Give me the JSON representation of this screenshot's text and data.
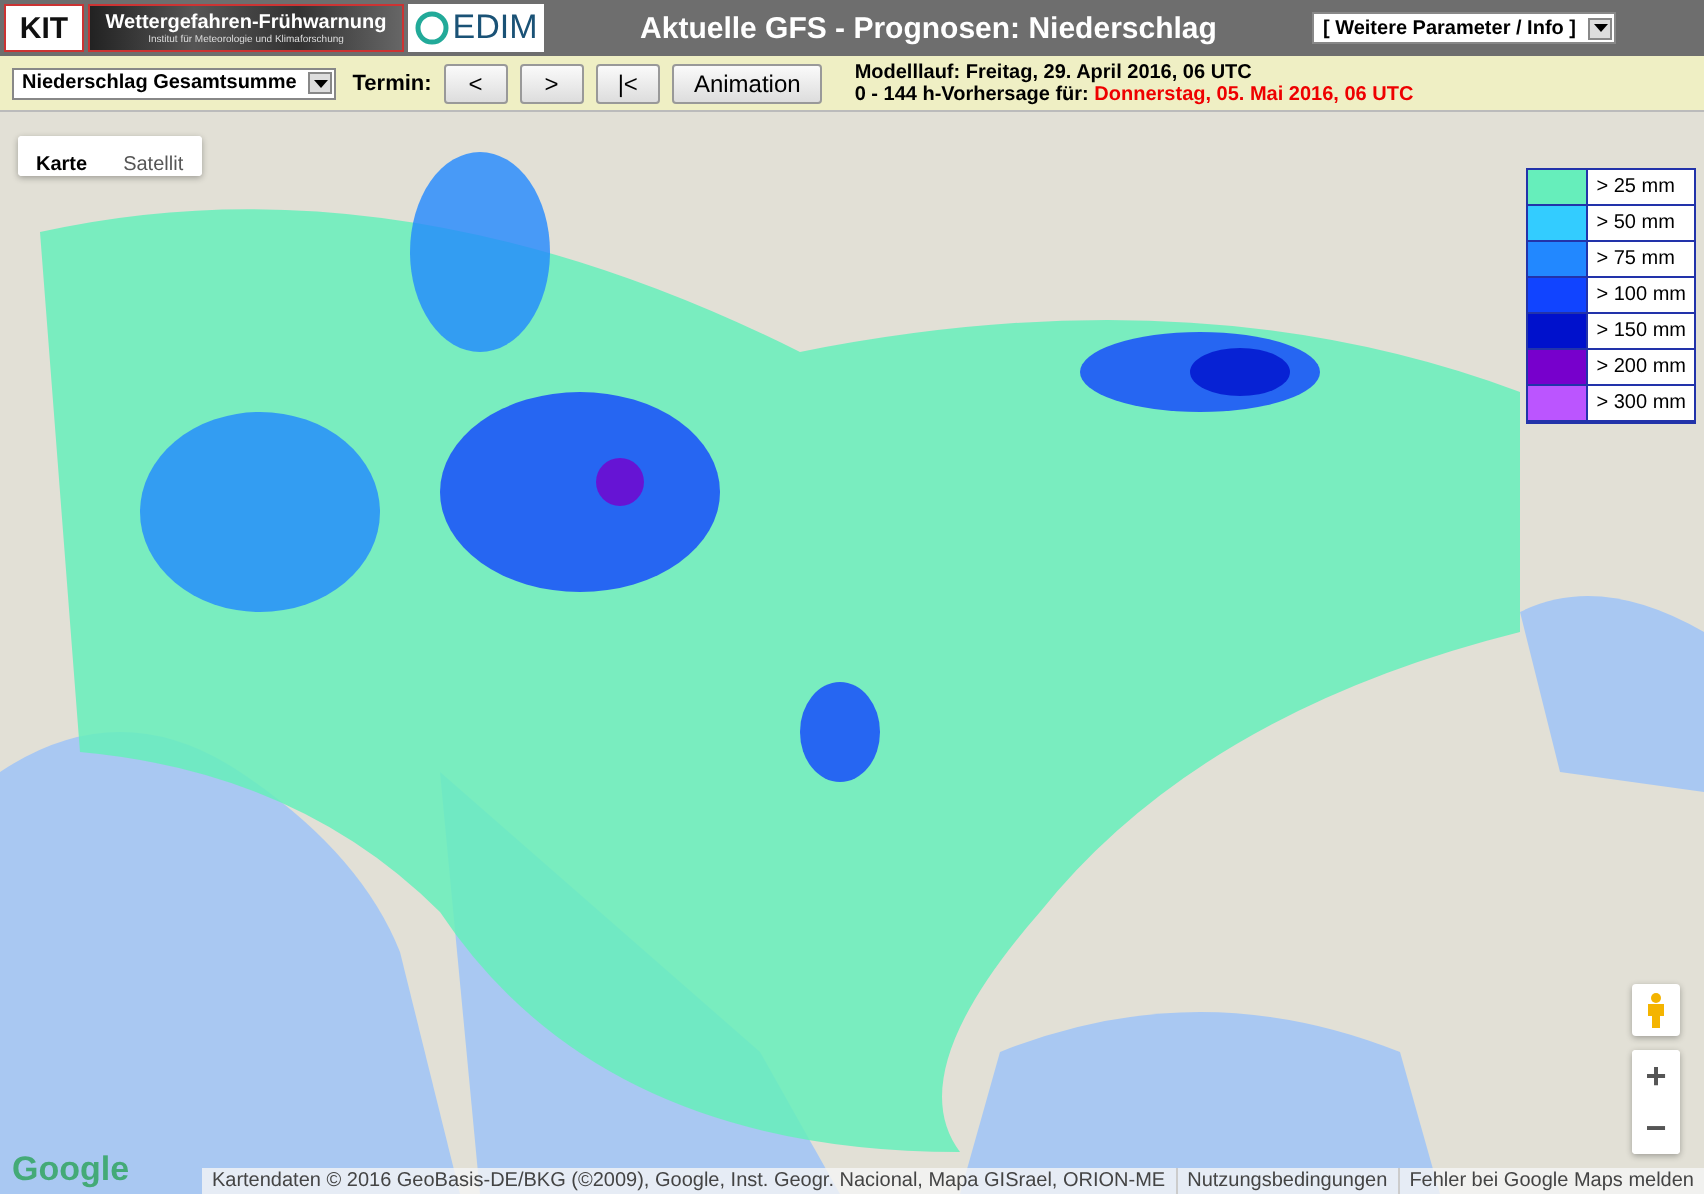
{
  "header": {
    "logos": [
      {
        "kind": "kit",
        "text": "KIT"
      },
      {
        "kind": "banner",
        "text": "Wettergefahren-Frühwarnung",
        "subtext": "Institut für Meteorologie und Klimaforschung"
      },
      {
        "kind": "cedim",
        "text": "EDIM"
      }
    ],
    "title": "Aktuelle GFS - Prognosen: Niederschlag",
    "menu": "[ Weitere Parameter / Info ]"
  },
  "toolbar": {
    "parameter": "Niederschlag Gesamtsumme",
    "termin_label": "Termin:",
    "buttons": [
      "<",
      ">",
      "|<",
      "Animation"
    ],
    "model_run": "Modelllauf: Freitag, 29. April 2016, 06 UTC",
    "forecast_label": "0 - 144 h-Vorhersage für:",
    "forecast_date": "Donnerstag, 05. Mai 2016, 06 UTC"
  },
  "map": {
    "type_tabs": [
      {
        "label": "Karte",
        "selected": true
      },
      {
        "label": "Satellit",
        "selected": false
      }
    ],
    "legend": [
      {
        "label": "> 25 mm",
        "color": "#66eebb"
      },
      {
        "label": "> 50 mm",
        "color": "#33ccff"
      },
      {
        "label": "> 75 mm",
        "color": "#2288ff"
      },
      {
        "label": "> 100 mm",
        "color": "#1144ff"
      },
      {
        "label": "> 150 mm",
        "color": "#0011cc"
      },
      {
        "label": "> 200 mm",
        "color": "#7700cc"
      },
      {
        "label": "> 300 mm",
        "color": "#bb55ff"
      }
    ],
    "zoom_in": "+",
    "zoom_out": "−",
    "brand": "Google",
    "attribution": "Kartendaten © 2016 GeoBasis-DE/BKG (©2009), Google, Inst. Geogr. Nacional, Mapa GISrael, ORION-ME",
    "terms": "Nutzungsbedingungen",
    "report": "Fehler bei Google Maps melden"
  }
}
